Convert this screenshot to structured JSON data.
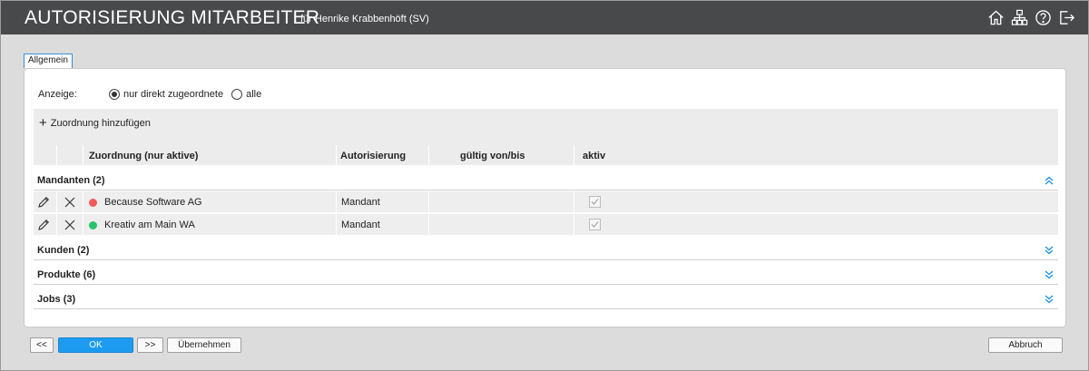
{
  "header": {
    "title": "AUTORISIERUNG MITARBEITER",
    "subtitle": "für Henrike Krabbenhöft (SV)",
    "icons": [
      "home-icon",
      "org-chart-icon",
      "help-icon",
      "logout-icon"
    ]
  },
  "tabs": [
    {
      "label": "Allgemein",
      "active": true
    }
  ],
  "filter": {
    "label": "Anzeige:",
    "options": [
      {
        "label": "nur direkt zugeordnete",
        "selected": true
      },
      {
        "label": "alle",
        "selected": false
      }
    ]
  },
  "toolbar": {
    "add_label": "Zuordnung hinzufügen"
  },
  "columns": {
    "zuordnung": "Zuordnung (nur aktive)",
    "autorisierung": "Autorisierung",
    "gueltig": "gültig von/bis",
    "aktiv": "aktiv"
  },
  "groups": [
    {
      "title": "Mandanten (2)",
      "expanded": true,
      "rows": [
        {
          "name": "Because Software AG",
          "status_color": "#f05a5a",
          "autorisierung": "Mandant",
          "gueltig": "",
          "aktiv": true
        },
        {
          "name": "Kreativ am Main WA",
          "status_color": "#27c46b",
          "autorisierung": "Mandant",
          "gueltig": "",
          "aktiv": true
        }
      ]
    },
    {
      "title": "Kunden (2)",
      "expanded": false
    },
    {
      "title": "Produkte (6)",
      "expanded": false
    },
    {
      "title": "Jobs (3)",
      "expanded": false
    }
  ],
  "buttons": {
    "prev": "<<",
    "ok": "OK",
    "next": ">>",
    "apply": "Übernehmen",
    "cancel": "Abbruch"
  },
  "colors": {
    "header_bg": "#48494b",
    "accent": "#1d9bf0",
    "chevron": "#1d8fe0"
  }
}
